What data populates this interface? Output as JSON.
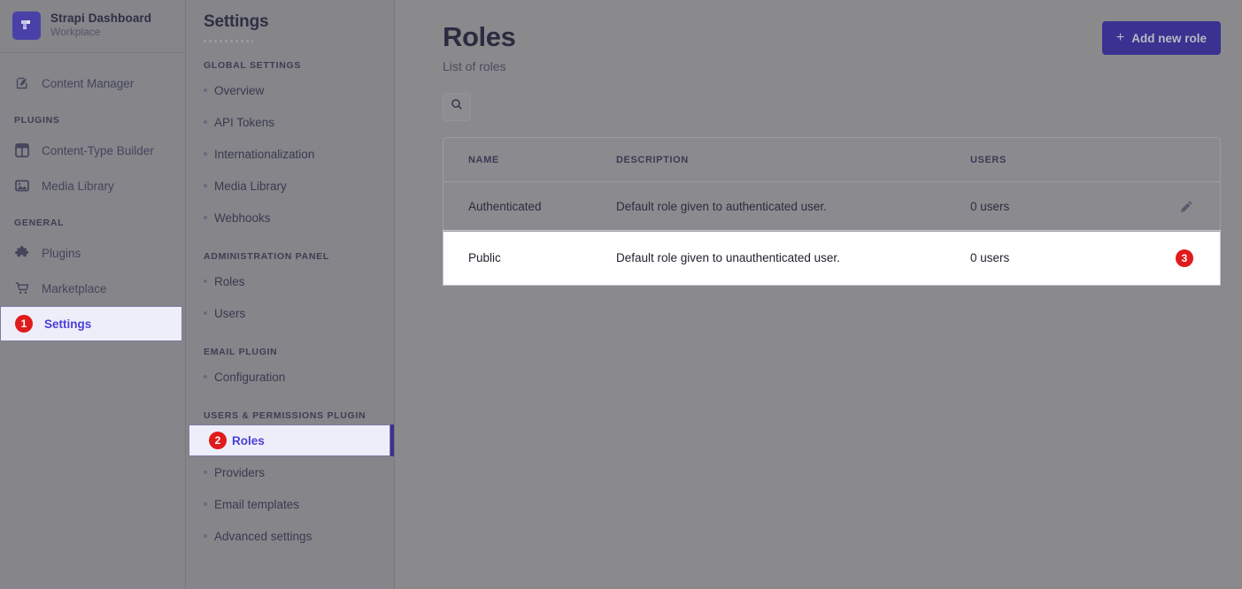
{
  "brand": {
    "logo_icon": "strapi-logo-icon",
    "title": "Strapi Dashboard",
    "subtitle": "Workplace"
  },
  "sidebar": {
    "items": [
      {
        "label": "Content Manager",
        "icon": "pen-square-icon",
        "type": "link",
        "active": false
      }
    ],
    "sections": [
      {
        "title": "PLUGINS",
        "items": [
          {
            "label": "Content-Type Builder",
            "icon": "layout-icon",
            "active": false
          },
          {
            "label": "Media Library",
            "icon": "image-icon",
            "active": false
          }
        ]
      },
      {
        "title": "GENERAL",
        "items": [
          {
            "label": "Plugins",
            "icon": "puzzle-icon",
            "active": false
          },
          {
            "label": "Marketplace",
            "icon": "shopping-cart-icon",
            "active": false
          },
          {
            "label": "Settings",
            "icon": "gear-icon",
            "active": true,
            "badge": "1"
          }
        ]
      }
    ]
  },
  "settings_panel": {
    "title": "Settings",
    "groups": [
      {
        "title": "GLOBAL SETTINGS",
        "links": [
          {
            "label": "Overview",
            "active": false
          },
          {
            "label": "API Tokens",
            "active": false
          },
          {
            "label": "Internationalization",
            "active": false
          },
          {
            "label": "Media Library",
            "active": false
          },
          {
            "label": "Webhooks",
            "active": false
          }
        ]
      },
      {
        "title": "ADMINISTRATION PANEL",
        "links": [
          {
            "label": "Roles",
            "active": false
          },
          {
            "label": "Users",
            "active": false
          }
        ]
      },
      {
        "title": "EMAIL PLUGIN",
        "links": [
          {
            "label": "Configuration",
            "active": false
          }
        ]
      },
      {
        "title": "USERS & PERMISSIONS PLUGIN",
        "links": [
          {
            "label": "Roles",
            "active": true,
            "badge": "2"
          },
          {
            "label": "Providers",
            "active": false
          },
          {
            "label": "Email templates",
            "active": false
          },
          {
            "label": "Advanced settings",
            "active": false
          }
        ]
      }
    ]
  },
  "main": {
    "title": "Roles",
    "subtitle": "List of roles",
    "add_button": {
      "label": "Add new role",
      "icon": "plus-icon"
    },
    "search": {
      "icon": "search-icon",
      "placeholder": ""
    },
    "table": {
      "columns": [
        "NAME",
        "DESCRIPTION",
        "USERS",
        ""
      ],
      "rows": [
        {
          "name": "Authenticated",
          "description": "Default role given to authenticated user.",
          "users": "0 users",
          "action_icon": "pencil-icon",
          "highlight": false,
          "badge": null
        },
        {
          "name": "Public",
          "description": "Default role given to unauthenticated user.",
          "users": "0 users",
          "action_icon": "pencil-icon",
          "highlight": true,
          "badge": "3"
        }
      ]
    }
  },
  "colors": {
    "brand_purple": "#4a3fd6",
    "button_purple": "#3b3191",
    "badge_red": "#e01b1b",
    "active_bg": "#eeeefb"
  }
}
